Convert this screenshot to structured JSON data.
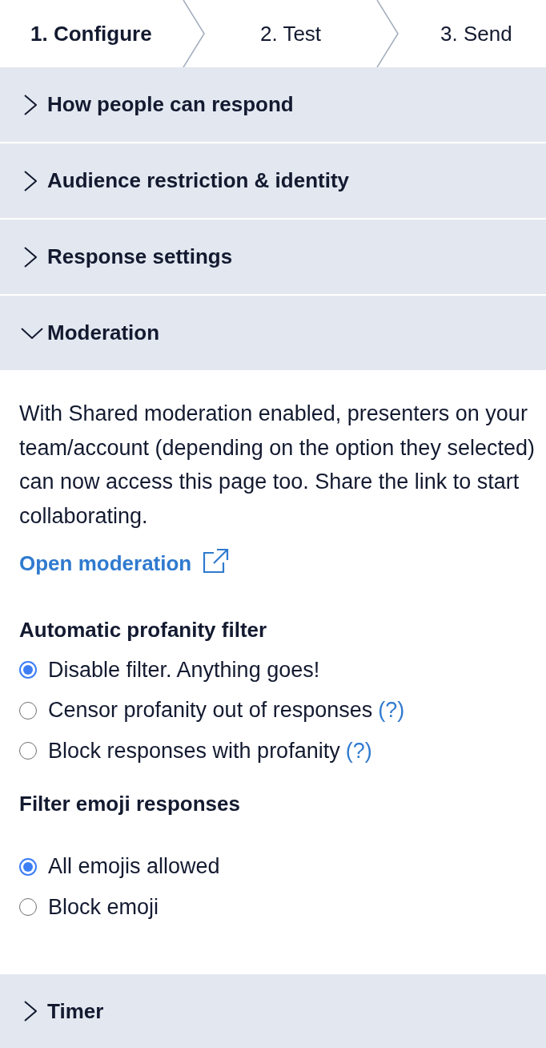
{
  "steps": [
    {
      "label": "1. Configure",
      "selected": true
    },
    {
      "label": "2. Test",
      "selected": false
    },
    {
      "label": "3. Send",
      "selected": false
    }
  ],
  "sections": [
    {
      "title": "How people can respond",
      "expanded": false
    },
    {
      "title": "Audience restriction & identity",
      "expanded": false
    },
    {
      "title": "Response settings",
      "expanded": false
    },
    {
      "title": "Moderation",
      "expanded": true,
      "description": "With Shared moderation enabled, presenters on your team/account (depending on the option they selected) can now access this page too. Share the link to start collaborating.",
      "link": "Open moderation",
      "groups": [
        {
          "title": "Automatic profanity filter",
          "options": [
            {
              "label": "Disable filter. Anything goes!",
              "selected": true
            },
            {
              "label": "Censor profanity out of responses",
              "help": "(?)",
              "selected": false
            },
            {
              "label": "Block responses with profanity",
              "help": "(?)",
              "selected": false
            }
          ]
        },
        {
          "title": "Filter emoji responses",
          "options": [
            {
              "label": "All emojis allowed",
              "selected": true
            },
            {
              "label": "Block emoji",
              "selected": false
            }
          ]
        }
      ]
    },
    {
      "title": "Timer",
      "expanded": false
    }
  ]
}
